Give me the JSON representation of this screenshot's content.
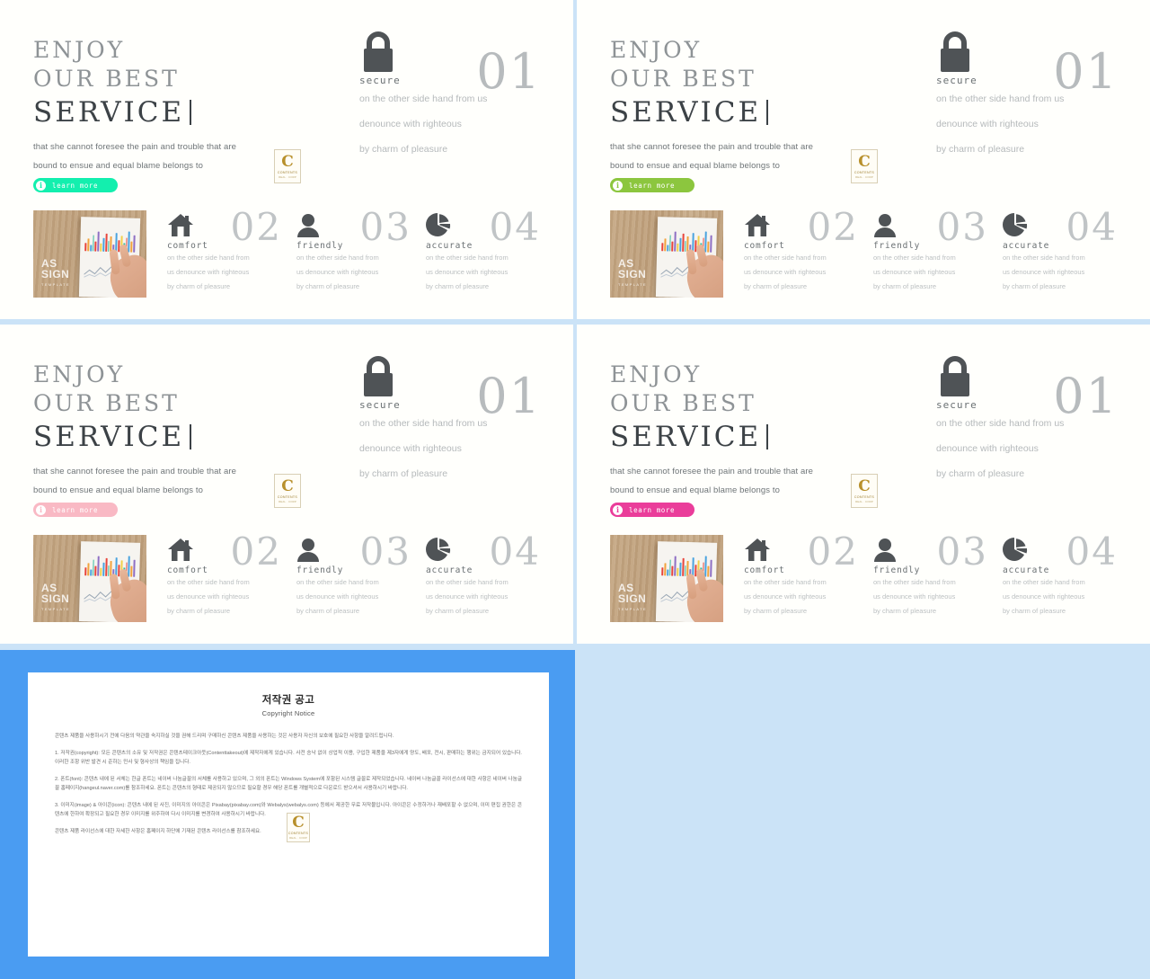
{
  "theme": {
    "page_background": "#cbe3f7",
    "slide_background": "#fffffc",
    "copyright_frame": "#4a9cf2",
    "heading_muted": "#8e9396",
    "heading_strong": "#3c4246",
    "number_grey": "#b7bbbd",
    "body_grey": "#b5b9bb"
  },
  "slide": {
    "headline": {
      "line1": "ENJOY",
      "line2": "OUR BEST",
      "line3": "SERVICE"
    },
    "lead": {
      "line1": "that she cannot foresee the pain and trouble that are",
      "line2": "bound to ensue and equal blame belongs to"
    },
    "learn_more": {
      "label": "learn more",
      "icon": "info-icon"
    },
    "badge": {
      "letter": "C",
      "name": "CONTENTS",
      "tagline": "REAL . CORP"
    },
    "thumbnail": {
      "watermark": "AS\nSIGN",
      "watermark_line1": "AS",
      "watermark_line2": "SIGN",
      "watermark_sub": "TEMPLATE",
      "alt": "desk photo with printed bar chart and hand"
    },
    "features": [
      {
        "icon": "lock-icon",
        "number": "01",
        "title": "secure",
        "desc1": "on the other side hand from us",
        "desc2": "denounce with righteous",
        "desc3": "by charm of pleasure"
      },
      {
        "icon": "home-icon",
        "number": "02",
        "title": "comfort",
        "desc1": "on the other side hand from",
        "desc2": "us denounce with righteous",
        "desc3": "by charm of pleasure"
      },
      {
        "icon": "person-icon",
        "number": "03",
        "title": "friendly",
        "desc1": "on the other side hand from",
        "desc2": "us denounce with righteous",
        "desc3": "by charm of pleasure"
      },
      {
        "icon": "pie-chart-icon",
        "number": "04",
        "title": "accurate",
        "desc1": "on the other side hand from",
        "desc2": "us denounce with righteous",
        "desc3": "by charm of pleasure"
      }
    ]
  },
  "variants": [
    {
      "id": "variant-1",
      "accent": "#13efae"
    },
    {
      "id": "variant-2",
      "accent": "#8cc63e"
    },
    {
      "id": "variant-3",
      "accent": "#f9b9c4"
    },
    {
      "id": "variant-4",
      "accent": "#ea3d9a"
    }
  ],
  "copyright": {
    "title": "저작권 공고",
    "subtitle": "Copyright Notice",
    "intro": "콘텐츠 제품을 사용하시기 전에 다음의 약관을 숙지하실 것을 권해 드리며 구매하신 콘텐츠 제품을 사용하는 것은 사용자 자신의 보호에 필요한 사항을 알려드립니다.",
    "section1": "1. 저작권(copyright): 모든 콘텐츠의 소유 및 저작권은 콘텐츠테이크아웃(Contenttakeout)에 제작자에게 있습니다. 사전 승낙 없이 상업적 이용, 구입한 제품을 제3자에게 양도, 배포, 전시, 판매하는 행위는 금지되어 있습니다. 이러한 조항 위반 발견 시 준하는 민사 및 형사상의 책임을 집니다.",
    "section2": "2. 폰트(font): 콘텐츠 내에 된 서체는 한글 폰트는 네이버 나눔글꼴의 서체를 사용하고 있으며, 그 외의 폰트는 Windows System에 포함된 시스템 글꼴로 제작되었습니다. 네이버 나눔글꼴 라이선스에 대한 사항은 네이버 나눔글꼴 홈페이지(hangeul.naver.com)를 참조하세요. 폰트는 콘텐츠의 형태로 제공되지 않으므로 필요할 경우 해당 폰트를 개별적으로 다운로드 받으셔서 사용하시기 바랍니다.",
    "section3": "3. 이미지(image) & 아이콘(icon): 콘텐츠 내에 된 사진, 이미지의 아이콘은 Pixabay(pixabay.com)와 Webalys(webalys.com) 등에서 제공한 무료 저작물입니다. 아이콘은 수정하거나 재배포할 수 없으며, 이미 편집 권한은 콘텐츠에 한하여 확장되고 필요한 경우 이미지를 위주하여 다시 이미지를 변경하여 사용하시기 바랍니다.",
    "outro": "콘텐츠 제품 라이선스에 대한 자세한 사항은 홈페이지 하단에 기재된 콘텐츠 라이선스를 참조하세요."
  }
}
